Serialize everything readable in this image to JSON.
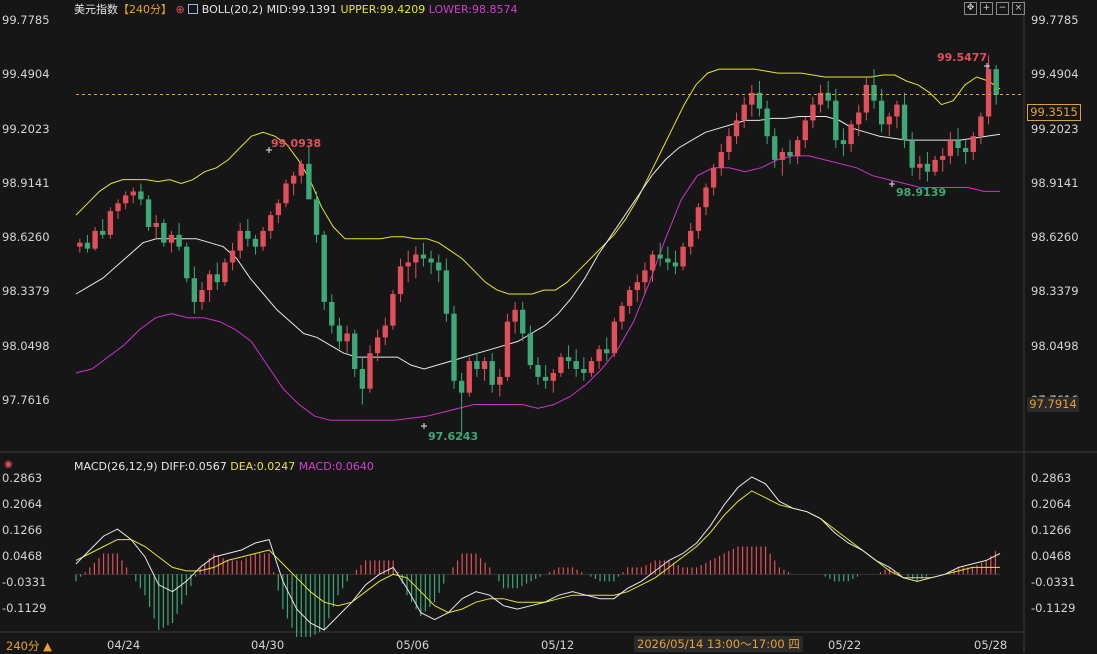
{
  "header": {
    "symbol": "美元指数",
    "period_tag": "【240分】",
    "boll_label": "BOLL(20,2)",
    "mid_label": "MID:99.1391",
    "upper_label": "UPPER:99.4209",
    "lower_label": "LOWER:98.8574"
  },
  "macd_header": {
    "title": "MACD(26,12,9)",
    "diff_label": "DIFF:0.0567",
    "dea_label": "DEA:0.0247",
    "macd_label": "MACD:0.0640"
  },
  "price_axis": [
    "99.7785",
    "99.4904",
    "99.2023",
    "98.9141",
    "98.6260",
    "98.3379",
    "98.0498",
    "97.7616"
  ],
  "macd_axis": [
    "0.2863",
    "0.2064",
    "0.1266",
    "0.0468",
    "-0.0331",
    "-0.1129"
  ],
  "current_price_tag": "99.3515",
  "cursor_price_tag": "97.7914",
  "annotations": {
    "high_1": "99.0938",
    "low_1": "97.6243",
    "high_2": "99.5477",
    "low_2": "98.9139"
  },
  "x_labels": [
    "04/24",
    "04/30",
    "05/06",
    "05/12",
    "05/22",
    "05/28"
  ],
  "crosshair_time": "2026/05/14 13:00～17:00 四",
  "period_button": "240分 ▲",
  "colors": {
    "up": "#e0505a",
    "down": "#3ea878",
    "upper": "#e6e62e",
    "mid": "#e8e8e8",
    "lower": "#cc33cc",
    "dea": "#e6e62e",
    "diff": "#e8e8e8",
    "last_price_line": "#e0a030"
  },
  "chart_data": [
    {
      "type": "candlestick",
      "title": "美元指数 240分",
      "indicator": "BOLL(20,2)",
      "yrange": [
        97.6,
        99.8
      ],
      "last_price": 99.3515,
      "candles": [
        [
          98.58,
          98.62,
          98.55,
          98.6
        ],
        [
          98.6,
          98.64,
          98.55,
          98.57
        ],
        [
          98.57,
          98.68,
          98.56,
          98.66
        ],
        [
          98.66,
          98.72,
          98.62,
          98.64
        ],
        [
          98.64,
          98.78,
          98.62,
          98.76
        ],
        [
          98.76,
          98.82,
          98.72,
          98.8
        ],
        [
          98.8,
          98.86,
          98.77,
          98.84
        ],
        [
          98.84,
          98.88,
          98.8,
          98.86
        ],
        [
          98.86,
          98.9,
          98.79,
          98.82
        ],
        [
          98.82,
          98.84,
          98.66,
          98.68
        ],
        [
          98.68,
          98.74,
          98.62,
          98.7
        ],
        [
          98.7,
          98.72,
          98.58,
          98.6
        ],
        [
          98.6,
          98.66,
          98.55,
          98.64
        ],
        [
          98.64,
          98.7,
          98.56,
          98.58
        ],
        [
          98.58,
          98.6,
          98.4,
          98.42
        ],
        [
          98.42,
          98.48,
          98.24,
          98.3
        ],
        [
          98.3,
          98.4,
          98.26,
          98.36
        ],
        [
          98.36,
          98.46,
          98.3,
          98.44
        ],
        [
          98.44,
          98.5,
          98.36,
          98.4
        ],
        [
          98.4,
          98.52,
          98.38,
          98.5
        ],
        [
          98.5,
          98.6,
          98.46,
          98.56
        ],
        [
          98.56,
          98.7,
          98.52,
          98.66
        ],
        [
          98.66,
          98.72,
          98.58,
          98.62
        ],
        [
          98.62,
          98.64,
          98.54,
          98.58
        ],
        [
          98.58,
          98.68,
          98.56,
          98.66
        ],
        [
          98.66,
          98.76,
          98.62,
          98.74
        ],
        [
          98.74,
          98.82,
          98.7,
          98.8
        ],
        [
          98.8,
          98.92,
          98.78,
          98.9
        ],
        [
          98.9,
          98.96,
          98.84,
          98.94
        ],
        [
          98.94,
          99.02,
          98.9,
          99.0
        ],
        [
          99.0,
          99.09,
          98.96,
          98.82
        ],
        [
          98.82,
          98.86,
          98.6,
          98.64
        ],
        [
          98.64,
          98.66,
          98.26,
          98.3
        ],
        [
          98.3,
          98.34,
          98.14,
          98.18
        ],
        [
          98.18,
          98.22,
          98.06,
          98.1
        ],
        [
          98.1,
          98.18,
          98.04,
          98.14
        ],
        [
          98.14,
          98.16,
          97.92,
          97.96
        ],
        [
          97.96,
          98.02,
          97.78,
          97.86
        ],
        [
          97.86,
          98.08,
          97.84,
          98.04
        ],
        [
          98.04,
          98.16,
          98.0,
          98.12
        ],
        [
          98.12,
          98.22,
          98.08,
          98.18
        ],
        [
          98.18,
          98.36,
          98.16,
          98.34
        ],
        [
          98.34,
          98.52,
          98.3,
          98.48
        ],
        [
          98.48,
          98.56,
          98.4,
          98.5
        ],
        [
          98.5,
          98.58,
          98.42,
          98.54
        ],
        [
          98.54,
          98.6,
          98.48,
          98.52
        ],
        [
          98.52,
          98.56,
          98.44,
          98.5
        ],
        [
          98.5,
          98.54,
          98.4,
          98.46
        ],
        [
          98.46,
          98.52,
          98.2,
          98.24
        ],
        [
          98.24,
          98.28,
          97.86,
          97.9
        ],
        [
          97.9,
          97.94,
          97.62,
          97.84
        ],
        [
          97.84,
          98.02,
          97.82,
          98.0
        ],
        [
          98.0,
          98.04,
          97.92,
          97.96
        ],
        [
          97.96,
          98.02,
          97.9,
          98.0
        ],
        [
          98.0,
          98.04,
          97.84,
          97.88
        ],
        [
          97.88,
          97.96,
          97.82,
          97.92
        ],
        [
          97.92,
          98.24,
          97.9,
          98.2
        ],
        [
          98.2,
          98.3,
          98.14,
          98.26
        ],
        [
          98.26,
          98.3,
          98.1,
          98.14
        ],
        [
          98.14,
          98.18,
          97.96,
          97.98
        ],
        [
          97.98,
          98.02,
          97.88,
          97.92
        ],
        [
          97.92,
          97.98,
          97.86,
          97.9
        ],
        [
          97.9,
          97.96,
          97.84,
          97.94
        ],
        [
          97.94,
          98.04,
          97.92,
          98.02
        ],
        [
          98.02,
          98.08,
          97.96,
          98.0
        ],
        [
          98.0,
          98.06,
          97.92,
          97.96
        ],
        [
          97.96,
          98.02,
          97.9,
          97.94
        ],
        [
          97.94,
          98.02,
          97.92,
          98.0
        ],
        [
          98.0,
          98.08,
          97.96,
          98.06
        ],
        [
          98.06,
          98.12,
          98.0,
          98.04
        ],
        [
          98.04,
          98.22,
          98.02,
          98.2
        ],
        [
          98.2,
          98.3,
          98.16,
          98.28
        ],
        [
          98.28,
          98.38,
          98.24,
          98.36
        ],
        [
          98.36,
          98.44,
          98.3,
          98.4
        ],
        [
          98.4,
          98.5,
          98.34,
          98.46
        ],
        [
          98.46,
          98.56,
          98.4,
          98.54
        ],
        [
          98.54,
          98.6,
          98.48,
          98.52
        ],
        [
          98.52,
          98.58,
          98.46,
          98.5
        ],
        [
          98.5,
          98.56,
          98.44,
          98.48
        ],
        [
          98.48,
          98.6,
          98.46,
          98.58
        ],
        [
          98.58,
          98.7,
          98.54,
          98.66
        ],
        [
          98.66,
          98.8,
          98.62,
          98.78
        ],
        [
          98.78,
          98.9,
          98.74,
          98.88
        ],
        [
          98.88,
          99.0,
          98.84,
          98.98
        ],
        [
          98.98,
          99.1,
          98.94,
          99.06
        ],
        [
          99.06,
          99.18,
          99.02,
          99.14
        ],
        [
          99.14,
          99.26,
          99.1,
          99.22
        ],
        [
          99.22,
          99.34,
          99.18,
          99.3
        ],
        [
          99.3,
          99.4,
          99.24,
          99.36
        ],
        [
          99.36,
          99.42,
          99.24,
          99.28
        ],
        [
          99.28,
          99.32,
          99.1,
          99.14
        ],
        [
          99.14,
          99.18,
          98.98,
          99.02
        ],
        [
          99.02,
          99.08,
          98.94,
          99.06
        ],
        [
          99.06,
          99.12,
          99.0,
          99.04
        ],
        [
          99.04,
          99.14,
          99.0,
          99.12
        ],
        [
          99.12,
          99.24,
          99.08,
          99.22
        ],
        [
          99.22,
          99.34,
          99.18,
          99.3
        ],
        [
          99.3,
          99.4,
          99.26,
          99.36
        ],
        [
          99.36,
          99.42,
          99.28,
          99.32
        ],
        [
          99.32,
          99.38,
          99.08,
          99.12
        ],
        [
          99.12,
          99.18,
          99.04,
          99.1
        ],
        [
          99.1,
          99.22,
          99.06,
          99.2
        ],
        [
          99.2,
          99.3,
          99.14,
          99.26
        ],
        [
          99.26,
          99.44,
          99.22,
          99.4
        ],
        [
          99.4,
          99.48,
          99.28,
          99.32
        ],
        [
          99.32,
          99.38,
          99.16,
          99.2
        ],
        [
          99.2,
          99.26,
          99.14,
          99.24
        ],
        [
          99.24,
          99.32,
          99.18,
          99.3
        ],
        [
          99.3,
          99.36,
          99.08,
          99.12
        ],
        [
          99.12,
          99.16,
          98.94,
          98.98
        ],
        [
          98.98,
          99.04,
          98.92,
          99.0
        ],
        [
          99.0,
          99.06,
          98.91,
          98.96
        ],
        [
          98.96,
          99.04,
          98.94,
          99.02
        ],
        [
          99.02,
          99.08,
          98.96,
          99.04
        ],
        [
          99.04,
          99.16,
          99.0,
          99.12
        ],
        [
          99.12,
          99.18,
          99.04,
          99.08
        ],
        [
          99.08,
          99.12,
          99.0,
          99.06
        ],
        [
          99.06,
          99.16,
          99.02,
          99.14
        ],
        [
          99.14,
          99.26,
          99.1,
          99.24
        ],
        [
          99.24,
          99.55,
          99.2,
          99.48
        ],
        [
          99.48,
          99.5,
          99.3,
          99.35
        ]
      ],
      "upper": [
        98.74,
        98.8,
        98.86,
        98.9,
        98.92,
        98.92,
        98.92,
        98.91,
        98.92,
        98.9,
        98.92,
        98.96,
        98.98,
        99.02,
        99.08,
        99.14,
        99.16,
        99.14,
        99.1,
        99.02,
        98.92,
        98.78,
        98.68,
        98.62,
        98.62,
        98.62,
        98.62,
        98.63,
        98.63,
        98.62,
        98.62,
        98.6,
        98.56,
        98.52,
        98.46,
        98.4,
        98.36,
        98.34,
        98.34,
        98.34,
        98.36,
        98.36,
        98.4,
        98.46,
        98.52,
        98.58,
        98.64,
        98.72,
        98.82,
        98.94,
        99.06,
        99.18,
        99.3,
        99.4,
        99.46,
        99.48,
        99.48,
        99.48,
        99.48,
        99.47,
        99.46,
        99.46,
        99.46,
        99.45,
        99.44,
        99.44,
        99.44,
        99.44,
        99.44,
        99.45,
        99.45,
        99.42,
        99.4,
        99.36,
        99.3,
        99.32,
        99.4,
        99.44,
        99.42,
        99.38
      ],
      "mid": [
        98.34,
        98.38,
        98.42,
        98.48,
        98.54,
        98.6,
        98.62,
        98.62,
        98.62,
        98.62,
        98.6,
        98.58,
        98.52,
        98.42,
        98.34,
        98.26,
        98.2,
        98.14,
        98.12,
        98.08,
        98.04,
        98.02,
        98.02,
        98.02,
        98.02,
        97.98,
        97.96,
        97.98,
        98.0,
        98.02,
        98.04,
        98.06,
        98.08,
        98.1,
        98.14,
        98.18,
        98.24,
        98.32,
        98.42,
        98.54,
        98.64,
        98.74,
        98.84,
        98.94,
        99.02,
        99.08,
        99.12,
        99.16,
        99.18,
        99.2,
        99.22,
        99.22,
        99.23,
        99.23,
        99.24,
        99.24,
        99.24,
        99.22,
        99.18,
        99.16,
        99.14,
        99.13,
        99.12,
        99.12,
        99.12,
        99.12,
        99.12,
        99.13,
        99.14,
        99.15
      ],
      "lower": [
        97.94,
        97.96,
        98.02,
        98.08,
        98.16,
        98.22,
        98.24,
        98.22,
        98.22,
        98.2,
        98.16,
        98.1,
        97.98,
        97.86,
        97.78,
        97.72,
        97.7,
        97.7,
        97.7,
        97.7,
        97.7,
        97.71,
        97.72,
        97.74,
        97.76,
        97.78,
        97.78,
        97.78,
        97.78,
        97.76,
        97.78,
        97.82,
        97.88,
        97.96,
        98.06,
        98.2,
        98.4,
        98.62,
        98.82,
        98.94,
        98.98,
        98.98,
        98.96,
        98.98,
        99.02,
        99.04,
        99.04,
        99.02,
        99.0,
        98.98,
        98.94,
        98.92,
        98.9,
        98.88,
        98.88,
        98.88,
        98.88,
        98.86,
        98.86
      ]
    },
    {
      "type": "bar+line",
      "title": "MACD(26,12,9)",
      "yrange": [
        -0.16,
        0.3
      ],
      "diff": [
        0.03,
        0.07,
        0.11,
        0.13,
        0.1,
        0.05,
        -0.03,
        -0.05,
        -0.02,
        0.02,
        0.05,
        0.06,
        0.07,
        0.09,
        0.1,
        -0.02,
        -0.1,
        -0.14,
        -0.16,
        -0.12,
        -0.08,
        -0.03,
        0.0,
        0.02,
        -0.04,
        -0.11,
        -0.13,
        -0.11,
        -0.07,
        -0.05,
        -0.06,
        -0.09,
        -0.1,
        -0.09,
        -0.08,
        -0.06,
        -0.05,
        -0.06,
        -0.07,
        -0.07,
        -0.04,
        -0.02,
        0.01,
        0.04,
        0.06,
        0.09,
        0.14,
        0.2,
        0.25,
        0.28,
        0.26,
        0.21,
        0.19,
        0.18,
        0.16,
        0.12,
        0.09,
        0.07,
        0.04,
        0.02,
        -0.01,
        -0.02,
        -0.01,
        0.0,
        0.02,
        0.03,
        0.04,
        0.06
      ],
      "dea": [
        0.04,
        0.06,
        0.08,
        0.1,
        0.1,
        0.08,
        0.05,
        0.02,
        0.01,
        0.01,
        0.02,
        0.04,
        0.05,
        0.06,
        0.07,
        0.03,
        -0.01,
        -0.05,
        -0.08,
        -0.09,
        -0.08,
        -0.05,
        -0.02,
        0.0,
        -0.01,
        -0.05,
        -0.09,
        -0.11,
        -0.1,
        -0.08,
        -0.07,
        -0.07,
        -0.08,
        -0.08,
        -0.08,
        -0.07,
        -0.06,
        -0.06,
        -0.06,
        -0.06,
        -0.05,
        -0.03,
        -0.01,
        0.02,
        0.05,
        0.08,
        0.12,
        0.17,
        0.21,
        0.24,
        0.22,
        0.2,
        0.19,
        0.18,
        0.16,
        0.13,
        0.1,
        0.07,
        0.04,
        0.01,
        -0.01,
        -0.01,
        -0.01,
        0.0,
        0.01,
        0.02,
        0.02,
        0.02
      ]
    }
  ]
}
